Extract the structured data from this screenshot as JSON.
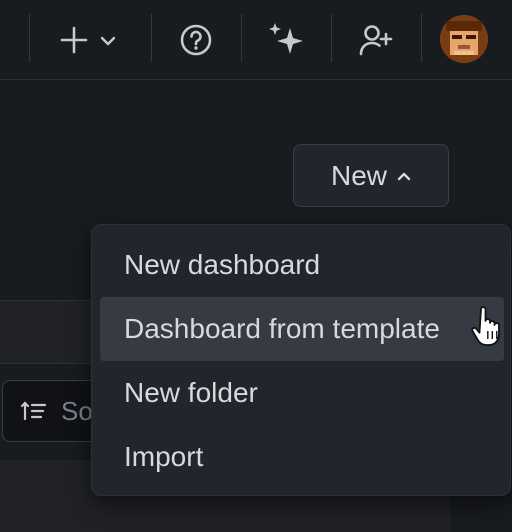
{
  "topbar": {
    "icons": [
      "plus-icon",
      "chevron-down-icon",
      "help-icon",
      "sparkle-icon",
      "invite-user-icon"
    ]
  },
  "new_button": {
    "label": "New",
    "icon": "chevron-up-icon"
  },
  "dropdown": {
    "items": [
      {
        "label": "New dashboard"
      },
      {
        "label": "Dashboard from template",
        "highlighted": true
      },
      {
        "label": "New folder"
      },
      {
        "label": "Import"
      }
    ]
  },
  "sort": {
    "text": "So",
    "icon": "sort-icon"
  },
  "colors": {
    "background": "#181b1f",
    "menu": "#22252b",
    "highlight": "#363a42",
    "text": "#d8d9dc"
  }
}
